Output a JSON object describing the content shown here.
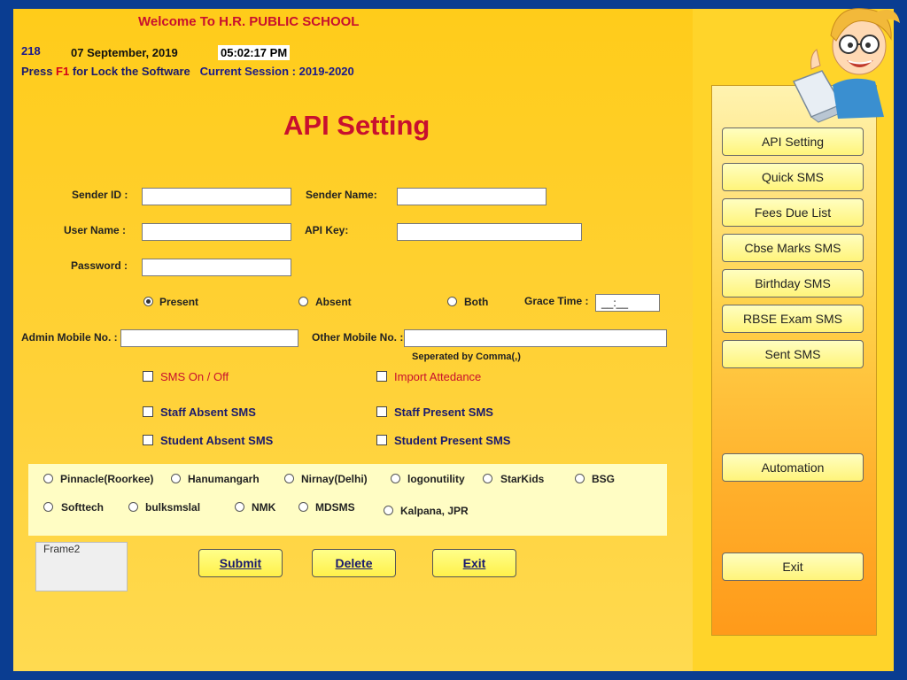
{
  "header": {
    "welcome": "Welcome To  H.R. PUBLIC SCHOOL",
    "code": "218",
    "date": "07 September, 2019",
    "time": "05:02:17 PM",
    "press": "Press",
    "key": "F1",
    "lock_text": "for Lock the Software",
    "session_label": "Current Session :",
    "session_value": "2019-2020"
  },
  "page_title": "API Setting",
  "form": {
    "sender_id_label": "Sender ID :",
    "sender_name_label": "Sender Name:",
    "user_name_label": "User Name :",
    "api_key_label": "API Key:",
    "password_label": "Password :",
    "radio_present": "Present",
    "radio_absent": "Absent",
    "radio_both": "Both",
    "grace_time_label": "Grace Time :",
    "grace_time_value": "__:__",
    "admin_mobile_label": "Admin Mobile No. :",
    "other_mobile_label": "Other Mobile No. :",
    "separated_hint": "Seperated by Comma(,)",
    "sms_on_off": "SMS On / Off",
    "import_attendance": "Import Attedance",
    "staff_absent": "Staff Absent SMS",
    "staff_present": "Staff Present SMS",
    "student_absent": "Student Absent SMS",
    "student_present": "Student Present SMS"
  },
  "providers": {
    "row1": [
      "Pinnacle(Roorkee)",
      "Hanumangarh",
      "Nirnay(Delhi)",
      "logonutility",
      "StarKids",
      "BSG"
    ],
    "row2": [
      "Softtech",
      "bulksmslal",
      "NMK",
      "MDSMS",
      "Kalpana, JPR"
    ]
  },
  "frame2_label": "Frame2",
  "buttons": {
    "submit": "Submit",
    "delete": "Delete",
    "exit": "Exit"
  },
  "side_menu": {
    "api_setting": "API Setting",
    "quick_sms": "Quick SMS",
    "fees_due": "Fees Due List",
    "cbse_marks": "Cbse Marks SMS",
    "birthday": "Birthday SMS",
    "rbse_exam": "RBSE Exam SMS",
    "sent_sms": "Sent SMS",
    "automation": "Automation",
    "exit": "Exit"
  },
  "colors": {
    "background_blue": "#0a3d91",
    "main_yellow": "#ffcc1a",
    "title_red": "#c8102e",
    "panel_orange": "#ff9a1a"
  }
}
